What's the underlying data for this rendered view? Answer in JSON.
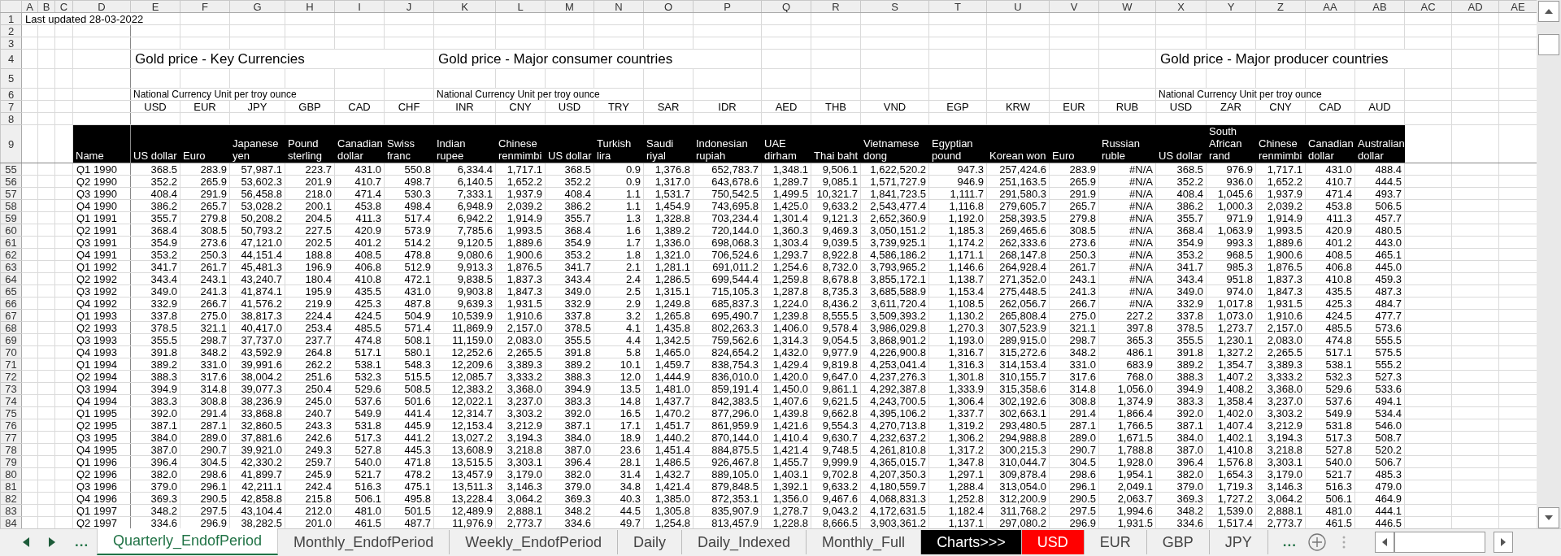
{
  "columns": [
    "A",
    "B",
    "C",
    "D",
    "E",
    "F",
    "G",
    "H",
    "I",
    "J",
    "K",
    "L",
    "M",
    "N",
    "O",
    "P",
    "Q",
    "R",
    "S",
    "T",
    "U",
    "V",
    "W",
    "X",
    "Y",
    "Z",
    "AA",
    "AB",
    "AC",
    "AD",
    "AE"
  ],
  "top_rows": [
    {
      "number": "1",
      "kind": "note",
      "text": "Last updated 28-03-2022"
    },
    {
      "number": "2",
      "kind": "blank"
    },
    {
      "number": "3",
      "kind": "blank"
    },
    {
      "number": "4",
      "kind": "titles",
      "cells": [
        "Gold price - Key Currencies",
        null,
        null,
        null,
        null,
        null,
        "Gold price - Major consumer countries",
        null,
        null,
        null,
        null,
        null,
        null,
        null,
        null,
        null,
        null,
        null,
        null,
        "Gold price - Major producer countries",
        null,
        null,
        null,
        null
      ]
    },
    {
      "number": "5",
      "kind": "blank"
    },
    {
      "number": "6",
      "kind": "units",
      "cells": [
        "National Currency Unit per troy ounce",
        null,
        null,
        null,
        null,
        null,
        "National Currency Unit per troy ounce",
        null,
        null,
        null,
        null,
        null,
        null,
        null,
        null,
        null,
        null,
        null,
        null,
        "National Currency Unit per troy ounce",
        null,
        null,
        null,
        null
      ]
    },
    {
      "number": "7",
      "kind": "codes",
      "cells": [
        "USD",
        "EUR",
        "JPY",
        "GBP",
        "CAD",
        "CHF",
        "INR",
        "CNY",
        "USD",
        "TRY",
        "SAR",
        "IDR",
        "AED",
        "THB",
        "VND",
        "EGP",
        "KRW",
        "EUR",
        "RUB",
        "USD",
        "ZAR",
        "CNY",
        "CAD",
        "AUD"
      ]
    },
    {
      "number": "8",
      "kind": "blank"
    },
    {
      "number": "9",
      "kind": "header",
      "name": "Name",
      "cells": [
        "US dollar",
        "Euro",
        "Japanese yen",
        "Pound sterling",
        "Canadian dollar",
        "Swiss franc",
        "Indian rupee",
        "Chinese renmimbi",
        "US dollar",
        "Turkish lira",
        "Saudi riyal",
        "Indonesian rupiah",
        "UAE dirham",
        "Thai baht",
        "Vietnamese dong",
        "Egyptian pound",
        "Korean won",
        "Euro",
        "Russian ruble",
        "US dollar",
        "South African rand",
        "Chinese renmimbi",
        "Canadian dollar",
        "Australian dollar"
      ]
    }
  ],
  "rows": [
    {
      "number": "55",
      "name": "Q1 1990",
      "values": [
        "368.5",
        "283.9",
        "57,987.1",
        "223.7",
        "431.0",
        "550.8",
        "6,334.4",
        "1,717.1",
        "368.5",
        "0.9",
        "1,376.8",
        "652,783.7",
        "1,348.1",
        "9,506.1",
        "1,622,520.2",
        "947.3",
        "257,424.6",
        "283.9",
        "#N/A",
        "368.5",
        "976.9",
        "1,717.1",
        "431.0",
        "488.4"
      ]
    },
    {
      "number": "56",
      "name": "Q2 1990",
      "values": [
        "352.2",
        "265.9",
        "53,602.3",
        "201.9",
        "410.7",
        "498.7",
        "6,140.5",
        "1,652.2",
        "352.2",
        "0.9",
        "1,317.0",
        "643,678.6",
        "1,289.7",
        "9,085.1",
        "1,571,727.9",
        "946.9",
        "251,163.5",
        "265.9",
        "#N/A",
        "352.2",
        "936.0",
        "1,652.2",
        "410.7",
        "444.5"
      ]
    },
    {
      "number": "57",
      "name": "Q3 1990",
      "values": [
        "408.4",
        "291.9",
        "56,458.8",
        "218.0",
        "471.4",
        "530.3",
        "7,333.1",
        "1,937.9",
        "408.4",
        "1.1",
        "1,531.7",
        "750,542.5",
        "1,499.5",
        "10,321.7",
        "1,841,723.5",
        "1,111.7",
        "291,580.3",
        "291.9",
        "#N/A",
        "408.4",
        "1,045.6",
        "1,937.9",
        "471.4",
        "493.7"
      ]
    },
    {
      "number": "58",
      "name": "Q4 1990",
      "values": [
        "386.2",
        "265.7",
        "53,028.2",
        "200.1",
        "453.8",
        "498.4",
        "6,948.9",
        "2,039.2",
        "386.2",
        "1.1",
        "1,454.9",
        "743,695.8",
        "1,425.0",
        "9,633.2",
        "2,543,477.4",
        "1,116.8",
        "279,605.7",
        "265.7",
        "#N/A",
        "386.2",
        "1,000.3",
        "2,039.2",
        "453.8",
        "506.5"
      ]
    },
    {
      "number": "59",
      "name": "Q1 1991",
      "values": [
        "355.7",
        "279.8",
        "50,208.2",
        "204.5",
        "411.3",
        "517.4",
        "6,942.2",
        "1,914.9",
        "355.7",
        "1.3",
        "1,328.8",
        "703,234.4",
        "1,301.4",
        "9,121.3",
        "2,652,360.9",
        "1,192.0",
        "258,393.5",
        "279.8",
        "#N/A",
        "355.7",
        "971.9",
        "1,914.9",
        "411.3",
        "457.7"
      ]
    },
    {
      "number": "60",
      "name": "Q2 1991",
      "values": [
        "368.4",
        "308.5",
        "50,793.2",
        "227.5",
        "420.9",
        "573.9",
        "7,785.6",
        "1,993.5",
        "368.4",
        "1.6",
        "1,389.2",
        "720,144.0",
        "1,360.3",
        "9,469.3",
        "3,050,151.2",
        "1,185.3",
        "269,465.6",
        "308.5",
        "#N/A",
        "368.4",
        "1,063.9",
        "1,993.5",
        "420.9",
        "480.5"
      ]
    },
    {
      "number": "61",
      "name": "Q3 1991",
      "values": [
        "354.9",
        "273.6",
        "47,121.0",
        "202.5",
        "401.2",
        "514.2",
        "9,120.5",
        "1,889.6",
        "354.9",
        "1.7",
        "1,336.0",
        "698,068.3",
        "1,303.4",
        "9,039.5",
        "3,739,925.1",
        "1,174.2",
        "262,333.6",
        "273.6",
        "#N/A",
        "354.9",
        "993.3",
        "1,889.6",
        "401.2",
        "443.0"
      ]
    },
    {
      "number": "62",
      "name": "Q4 1991",
      "values": [
        "353.2",
        "250.3",
        "44,151.4",
        "188.8",
        "408.5",
        "478.8",
        "9,080.6",
        "1,900.6",
        "353.2",
        "1.8",
        "1,321.0",
        "706,524.6",
        "1,293.7",
        "8,922.8",
        "4,586,186.2",
        "1,171.1",
        "268,147.8",
        "250.3",
        "#N/A",
        "353.2",
        "968.5",
        "1,900.6",
        "408.5",
        "465.1"
      ]
    },
    {
      "number": "63",
      "name": "Q1 1992",
      "values": [
        "341.7",
        "261.7",
        "45,481.3",
        "196.9",
        "406.8",
        "512.9",
        "9,913.3",
        "1,876.5",
        "341.7",
        "2.1",
        "1,281.1",
        "691,011.2",
        "1,254.6",
        "8,732.0",
        "3,793,965.2",
        "1,146.6",
        "264,928.4",
        "261.7",
        "#N/A",
        "341.7",
        "985.3",
        "1,876.5",
        "406.8",
        "445.0"
      ]
    },
    {
      "number": "64",
      "name": "Q2 1992",
      "values": [
        "343.4",
        "243.1",
        "43,240.7",
        "180.4",
        "410.8",
        "472.1",
        "9,838.5",
        "1,837.3",
        "343.4",
        "2.4",
        "1,286.5",
        "699,544.4",
        "1,259.8",
        "8,678.8",
        "3,855,172.1",
        "1,138.7",
        "271,352.0",
        "243.1",
        "#N/A",
        "343.4",
        "951.8",
        "1,837.3",
        "410.8",
        "459.3"
      ]
    },
    {
      "number": "65",
      "name": "Q3 1992",
      "values": [
        "349.0",
        "241.3",
        "41,874.1",
        "195.9",
        "435.5",
        "431.0",
        "9,903.8",
        "1,847.3",
        "349.0",
        "2.5",
        "1,315.1",
        "715,105.3",
        "1,287.8",
        "8,735.3",
        "3,685,588.9",
        "1,153.4",
        "275,448.5",
        "241.3",
        "#N/A",
        "349.0",
        "974.0",
        "1,847.3",
        "435.5",
        "487.3"
      ]
    },
    {
      "number": "66",
      "name": "Q4 1992",
      "values": [
        "332.9",
        "266.7",
        "41,576.2",
        "219.9",
        "425.3",
        "487.8",
        "9,639.3",
        "1,931.5",
        "332.9",
        "2.9",
        "1,249.8",
        "685,837.3",
        "1,224.0",
        "8,436.2",
        "3,611,720.4",
        "1,108.5",
        "262,056.7",
        "266.7",
        "#N/A",
        "332.9",
        "1,017.8",
        "1,931.5",
        "425.3",
        "484.7"
      ]
    },
    {
      "number": "67",
      "name": "Q1 1993",
      "values": [
        "337.8",
        "275.0",
        "38,817.3",
        "224.4",
        "424.5",
        "504.9",
        "10,539.9",
        "1,910.6",
        "337.8",
        "3.2",
        "1,265.8",
        "695,490.7",
        "1,239.8",
        "8,555.5",
        "3,509,393.2",
        "1,130.2",
        "265,808.4",
        "275.0",
        "227.2",
        "337.8",
        "1,073.0",
        "1,910.6",
        "424.5",
        "477.7"
      ]
    },
    {
      "number": "68",
      "name": "Q2 1993",
      "values": [
        "378.5",
        "321.1",
        "40,417.0",
        "253.4",
        "485.5",
        "571.4",
        "11,869.9",
        "2,157.0",
        "378.5",
        "4.1",
        "1,435.8",
        "802,263.3",
        "1,406.0",
        "9,578.4",
        "3,986,029.8",
        "1,270.3",
        "307,523.9",
        "321.1",
        "397.8",
        "378.5",
        "1,273.7",
        "2,157.0",
        "485.5",
        "573.6"
      ]
    },
    {
      "number": "69",
      "name": "Q3 1993",
      "values": [
        "355.5",
        "298.7",
        "37,737.0",
        "237.7",
        "474.8",
        "508.1",
        "11,159.0",
        "2,083.0",
        "355.5",
        "4.4",
        "1,342.5",
        "759,562.6",
        "1,314.3",
        "9,054.5",
        "3,868,901.2",
        "1,193.0",
        "289,915.0",
        "298.7",
        "365.3",
        "355.5",
        "1,230.1",
        "2,083.0",
        "474.8",
        "555.5"
      ]
    },
    {
      "number": "70",
      "name": "Q4 1993",
      "values": [
        "391.8",
        "348.2",
        "43,592.9",
        "264.8",
        "517.1",
        "580.1",
        "12,252.6",
        "2,265.5",
        "391.8",
        "5.8",
        "1,465.0",
        "824,654.2",
        "1,432.0",
        "9,977.9",
        "4,226,900.8",
        "1,316.7",
        "315,272.6",
        "348.2",
        "486.1",
        "391.8",
        "1,327.2",
        "2,265.5",
        "517.1",
        "575.5"
      ]
    },
    {
      "number": "71",
      "name": "Q1 1994",
      "values": [
        "389.2",
        "331.0",
        "39,991.6",
        "262.2",
        "538.1",
        "548.3",
        "12,209.6",
        "3,389.3",
        "389.2",
        "10.1",
        "1,459.7",
        "838,754.3",
        "1,429.4",
        "9,819.8",
        "4,253,041.4",
        "1,316.3",
        "314,153.4",
        "331.0",
        "683.9",
        "389.2",
        "1,354.7",
        "3,389.3",
        "538.1",
        "555.2"
      ]
    },
    {
      "number": "72",
      "name": "Q2 1994",
      "values": [
        "388.3",
        "317.6",
        "38,004.2",
        "251.6",
        "532.3",
        "515.5",
        "12,085.7",
        "3,333.2",
        "388.3",
        "12.0",
        "1,444.9",
        "836,010.0",
        "1,420.0",
        "9,647.0",
        "4,237,276.3",
        "1,301.8",
        "310,155.7",
        "317.6",
        "768.0",
        "388.3",
        "1,407.2",
        "3,333.2",
        "532.3",
        "527.3"
      ]
    },
    {
      "number": "73",
      "name": "Q3 1994",
      "values": [
        "394.9",
        "314.8",
        "39,077.3",
        "250.4",
        "529.6",
        "508.5",
        "12,383.2",
        "3,368.0",
        "394.9",
        "13.5",
        "1,481.0",
        "859,191.4",
        "1,450.0",
        "9,861.1",
        "4,292,387.8",
        "1,333.9",
        "315,358.6",
        "314.8",
        "1,056.0",
        "394.9",
        "1,408.2",
        "3,368.0",
        "529.6",
        "533.6"
      ]
    },
    {
      "number": "74",
      "name": "Q4 1994",
      "values": [
        "383.3",
        "308.8",
        "38,236.9",
        "245.0",
        "537.6",
        "501.6",
        "12,022.1",
        "3,237.0",
        "383.3",
        "14.8",
        "1,437.7",
        "842,383.5",
        "1,407.6",
        "9,621.5",
        "4,243,700.5",
        "1,306.4",
        "302,192.6",
        "308.8",
        "1,374.9",
        "383.3",
        "1,358.4",
        "3,237.0",
        "537.6",
        "494.1"
      ]
    },
    {
      "number": "75",
      "name": "Q1 1995",
      "values": [
        "392.0",
        "291.4",
        "33,868.8",
        "240.7",
        "549.9",
        "441.4",
        "12,314.7",
        "3,303.2",
        "392.0",
        "16.5",
        "1,470.2",
        "877,296.0",
        "1,439.8",
        "9,662.8",
        "4,395,106.2",
        "1,337.7",
        "302,663.1",
        "291.4",
        "1,866.4",
        "392.0",
        "1,402.0",
        "3,303.2",
        "549.9",
        "534.4"
      ]
    },
    {
      "number": "76",
      "name": "Q2 1995",
      "values": [
        "387.1",
        "287.1",
        "32,860.5",
        "243.3",
        "531.8",
        "445.9",
        "12,153.4",
        "3,212.9",
        "387.1",
        "17.1",
        "1,451.7",
        "861,959.9",
        "1,421.6",
        "9,554.3",
        "4,270,713.8",
        "1,319.2",
        "293,480.5",
        "287.1",
        "1,766.5",
        "387.1",
        "1,407.4",
        "3,212.9",
        "531.8",
        "546.0"
      ]
    },
    {
      "number": "77",
      "name": "Q3 1995",
      "values": [
        "384.0",
        "289.0",
        "37,881.6",
        "242.6",
        "517.3",
        "441.2",
        "13,027.2",
        "3,194.3",
        "384.0",
        "18.9",
        "1,440.2",
        "870,144.0",
        "1,410.4",
        "9,630.7",
        "4,232,637.2",
        "1,306.2",
        "294,988.8",
        "289.0",
        "1,671.5",
        "384.0",
        "1,402.1",
        "3,194.3",
        "517.3",
        "508.7"
      ]
    },
    {
      "number": "78",
      "name": "Q4 1995",
      "values": [
        "387.0",
        "290.7",
        "39,921.0",
        "249.3",
        "527.8",
        "445.3",
        "13,608.9",
        "3,218.8",
        "387.0",
        "23.6",
        "1,451.4",
        "884,875.5",
        "1,421.4",
        "9,748.5",
        "4,261,810.8",
        "1,317.2",
        "300,215.3",
        "290.7",
        "1,788.8",
        "387.0",
        "1,410.8",
        "3,218.8",
        "527.8",
        "520.2"
      ]
    },
    {
      "number": "79",
      "name": "Q1 1996",
      "values": [
        "396.4",
        "304.5",
        "42,330.2",
        "259.7",
        "540.0",
        "471.8",
        "13,515.5",
        "3,303.1",
        "396.4",
        "28.1",
        "1,486.5",
        "926,467.8",
        "1,455.7",
        "9,999.9",
        "4,365,015.7",
        "1,347.8",
        "310,044.7",
        "304.5",
        "1,928.0",
        "396.4",
        "1,576.8",
        "3,303.1",
        "540.0",
        "506.7"
      ]
    },
    {
      "number": "80",
      "name": "Q2 1996",
      "values": [
        "382.0",
        "298.6",
        "41,899.7",
        "245.9",
        "521.7",
        "478.2",
        "13,457.9",
        "3,179.0",
        "382.0",
        "31.4",
        "1,432.7",
        "889,105.0",
        "1,403.1",
        "9,702.8",
        "4,207,350.3",
        "1,297.1",
        "309,878.4",
        "298.6",
        "1,954.1",
        "382.0",
        "1,654.3",
        "3,179.0",
        "521.7",
        "485.3"
      ]
    },
    {
      "number": "81",
      "name": "Q3 1996",
      "values": [
        "379.0",
        "296.1",
        "42,211.1",
        "242.4",
        "516.3",
        "475.1",
        "13,511.3",
        "3,146.3",
        "379.0",
        "34.8",
        "1,421.4",
        "879,848.5",
        "1,392.1",
        "9,633.2",
        "4,180,559.7",
        "1,288.4",
        "313,054.0",
        "296.1",
        "2,049.1",
        "379.0",
        "1,719.3",
        "3,146.3",
        "516.3",
        "479.0"
      ]
    },
    {
      "number": "82",
      "name": "Q4 1996",
      "values": [
        "369.3",
        "290.5",
        "42,858.8",
        "215.8",
        "506.1",
        "495.8",
        "13,228.4",
        "3,064.2",
        "369.3",
        "40.3",
        "1,385.0",
        "872,353.1",
        "1,356.0",
        "9,467.6",
        "4,068,831.3",
        "1,252.8",
        "312,200.9",
        "290.5",
        "2,063.7",
        "369.3",
        "1,727.2",
        "3,064.2",
        "506.1",
        "464.9"
      ]
    },
    {
      "number": "83",
      "name": "Q1 1997",
      "values": [
        "348.2",
        "297.5",
        "43,104.4",
        "212.0",
        "481.0",
        "501.5",
        "12,489.9",
        "2,888.1",
        "348.2",
        "44.5",
        "1,305.8",
        "835,907.9",
        "1,278.7",
        "9,043.2",
        "4,172,631.5",
        "1,182.4",
        "311,768.2",
        "297.5",
        "1,994.6",
        "348.2",
        "1,539.0",
        "2,888.1",
        "481.0",
        "444.1"
      ]
    },
    {
      "number": "84",
      "name": "Q2 1997",
      "values": [
        "334.6",
        "296.9",
        "38,282.5",
        "201.0",
        "461.5",
        "487.7",
        "11,976.9",
        "2,773.7",
        "334.6",
        "49.7",
        "1,254.8",
        "813,457.9",
        "1,228.8",
        "8,666.5",
        "3,903,361.2",
        "1,137.1",
        "297,080.2",
        "296.9",
        "1,931.5",
        "334.6",
        "1,517.4",
        "2,773.7",
        "461.5",
        "446.5"
      ]
    }
  ],
  "sheet_tabs": {
    "more_left": "...",
    "more_right": "...",
    "tabs": [
      {
        "label": "Quarterly_EndofPeriod",
        "selected": true
      },
      {
        "label": "Monthly_EndofPeriod",
        "selected": false
      },
      {
        "label": "Weekly_EndofPeriod",
        "selected": false
      },
      {
        "label": "Daily",
        "selected": false
      },
      {
        "label": "Daily_Indexed",
        "selected": false
      },
      {
        "label": "Monthly_Full",
        "selected": false
      },
      {
        "label": "Charts>>>",
        "selected": false,
        "color": "#000000"
      },
      {
        "label": "USD",
        "selected": false,
        "color": "#ff0000"
      },
      {
        "label": "EUR",
        "selected": false
      },
      {
        "label": "GBP",
        "selected": false
      },
      {
        "label": "JPY",
        "selected": false
      }
    ]
  }
}
